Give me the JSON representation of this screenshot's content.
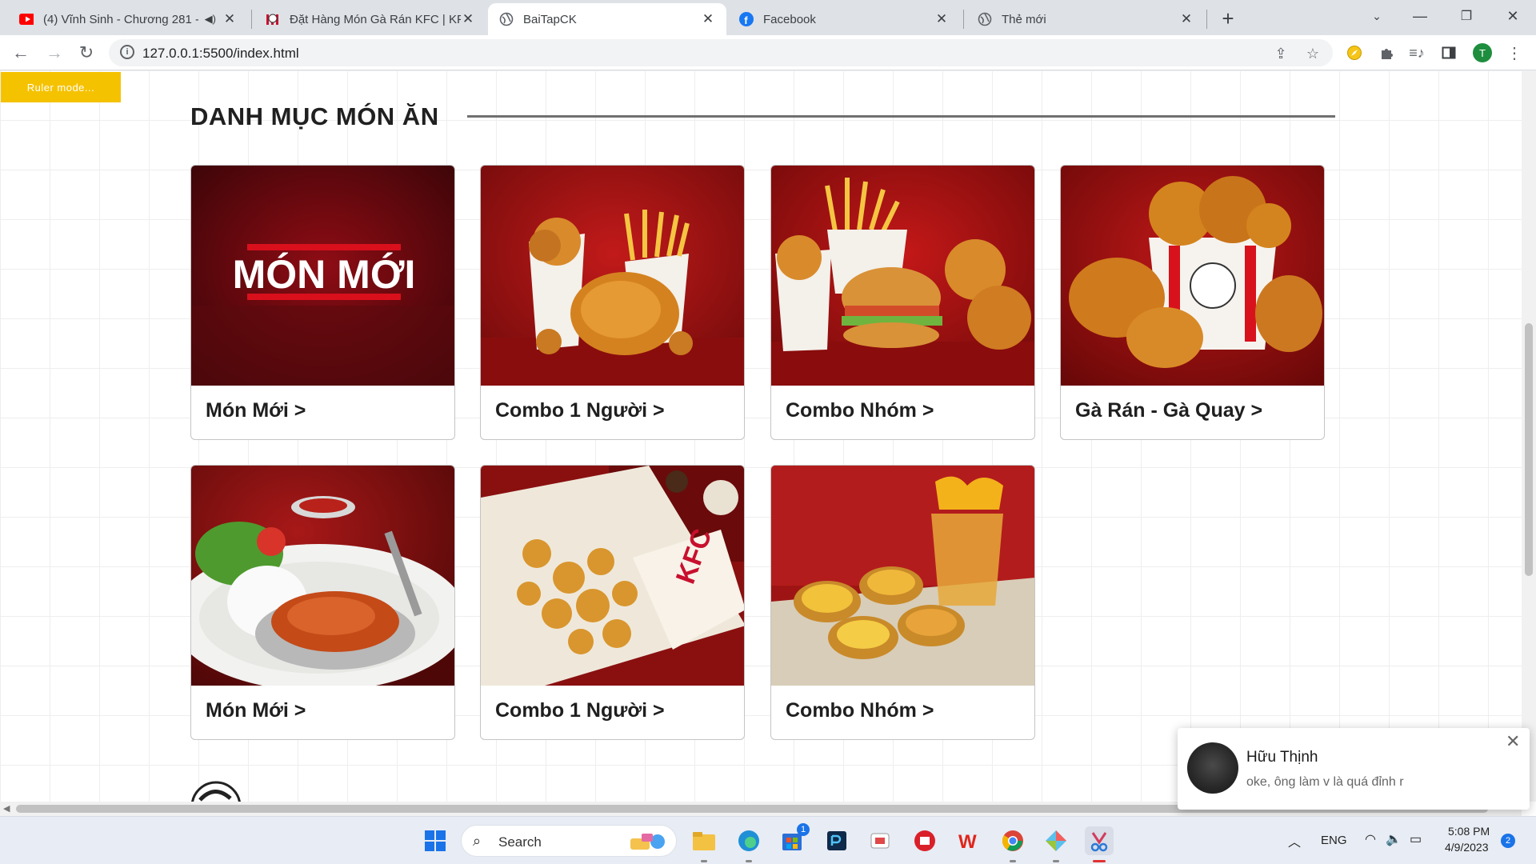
{
  "browser": {
    "tabs": [
      {
        "title": "(4) Vĩnh Sinh - Chương 281 -",
        "icon": "youtube-icon",
        "active": false
      },
      {
        "title": "Đặt Hàng Món Gà Rán KFC | KFC",
        "icon": "kfc-icon",
        "active": false
      },
      {
        "title": "BaiTapCK",
        "icon": "globe-icon",
        "active": true
      },
      {
        "title": "Facebook",
        "icon": "facebook-icon",
        "active": false
      },
      {
        "title": "Thẻ mới",
        "icon": "globe-icon",
        "active": false
      }
    ],
    "url": "127.0.0.1:5500/index.html",
    "profile_initial": "T"
  },
  "page": {
    "ruler_button": "Ruler mode...",
    "section_title": "DANH MỤC MÓN ĂN",
    "categories": [
      {
        "label": "Món Mới >",
        "image": "mon-moi-banner"
      },
      {
        "label": "Combo 1 Người >",
        "image": "combo-chicken-fries"
      },
      {
        "label": "Combo Nhóm >",
        "image": "combo-burger-fries"
      },
      {
        "label": "Gà Rán - Gà Quay >",
        "image": "fried-chicken-bucket"
      },
      {
        "label": "Món Mới >",
        "image": "rice-plate"
      },
      {
        "label": "Combo 1 Người >",
        "image": "popcorn-chicken"
      },
      {
        "label": "Combo Nhóm >",
        "image": "egg-tarts-tea"
      }
    ],
    "banner_text": "MÓN MỚI"
  },
  "notification": {
    "sender": "Hữu Thịnh",
    "message": "oke, ông làm v là quá đỉnh r"
  },
  "taskbar": {
    "search_label": "Search",
    "language": "ENG",
    "time": "5:08 PM",
    "date": "4/9/2023",
    "notification_count": "2",
    "store_badge": "1"
  },
  "colors": {
    "kfc_red": "#b0141c",
    "ruler_yellow": "#f5c200",
    "chrome_gray": "#dee1e6"
  }
}
